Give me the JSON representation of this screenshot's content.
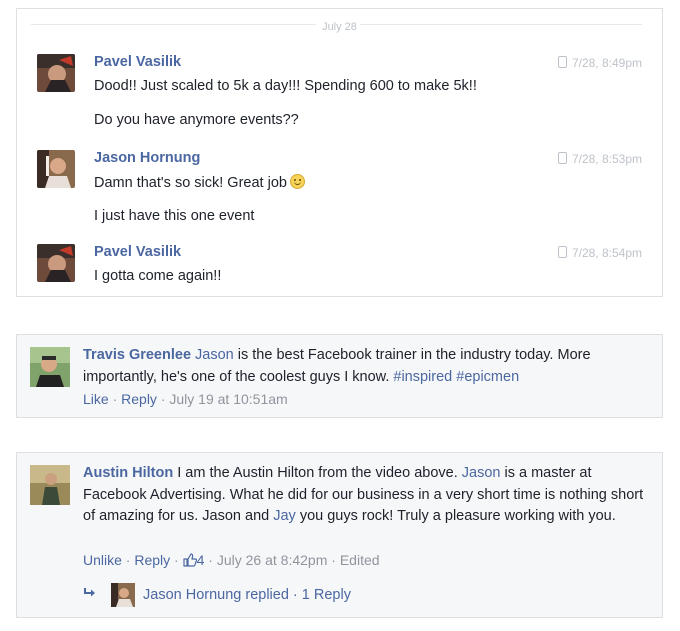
{
  "chat": {
    "date_divider": "July 28",
    "groups": [
      {
        "name": "Pavel Vasilik",
        "timestamp": "7/28, 8:49pm",
        "lines": [
          "Dood!! Just scaled to 5k a day!!! Spending 600 to make 5k!!",
          "Do you have anymore events??"
        ]
      },
      {
        "name": "Jason Hornung",
        "timestamp": "7/28, 8:53pm",
        "lines": [
          "Damn that's so sick! Great job",
          "I just have this one event"
        ],
        "emoji": "smile-emoji"
      },
      {
        "name": "Pavel Vasilik",
        "timestamp": "7/28, 8:54pm",
        "lines": [
          "I gotta come again!!"
        ]
      }
    ]
  },
  "comments": [
    {
      "author": "Travis Greenlee",
      "text_parts": [
        "Jason",
        " is the best Facebook trainer in the industry today. More importantly, he's one of the coolest guys I know. ",
        "#inspired",
        " ",
        "#epicmen"
      ],
      "actions": {
        "like": "Like",
        "reply": "Reply",
        "time": "July 19 at 10:51am",
        "sep": " · "
      }
    },
    {
      "author": "Austin Hilton",
      "text_parts": [
        " I am the Austin Hilton from the video above. ",
        "Jason",
        " is a master at Facebook Advertising. What he did for our business in a very short time is nothing short of amazing for us. Jason and ",
        "Jay",
        " you guys rock! Truly a pleasure working with you."
      ],
      "actions": {
        "like": "Unlike",
        "reply": "Reply",
        "like_count": "4",
        "time": "July 26 at 8:42pm",
        "edited": "Edited",
        "sep": " · "
      },
      "reply_summary": {
        "text": "Jason Hornung replied",
        "count": "1 Reply",
        "sep": " · "
      }
    }
  ],
  "colors": {
    "link": "#4b67a1",
    "meta": "#90949c",
    "timestamp": "#bec3c9",
    "comment_bg": "#f6f7f9"
  }
}
